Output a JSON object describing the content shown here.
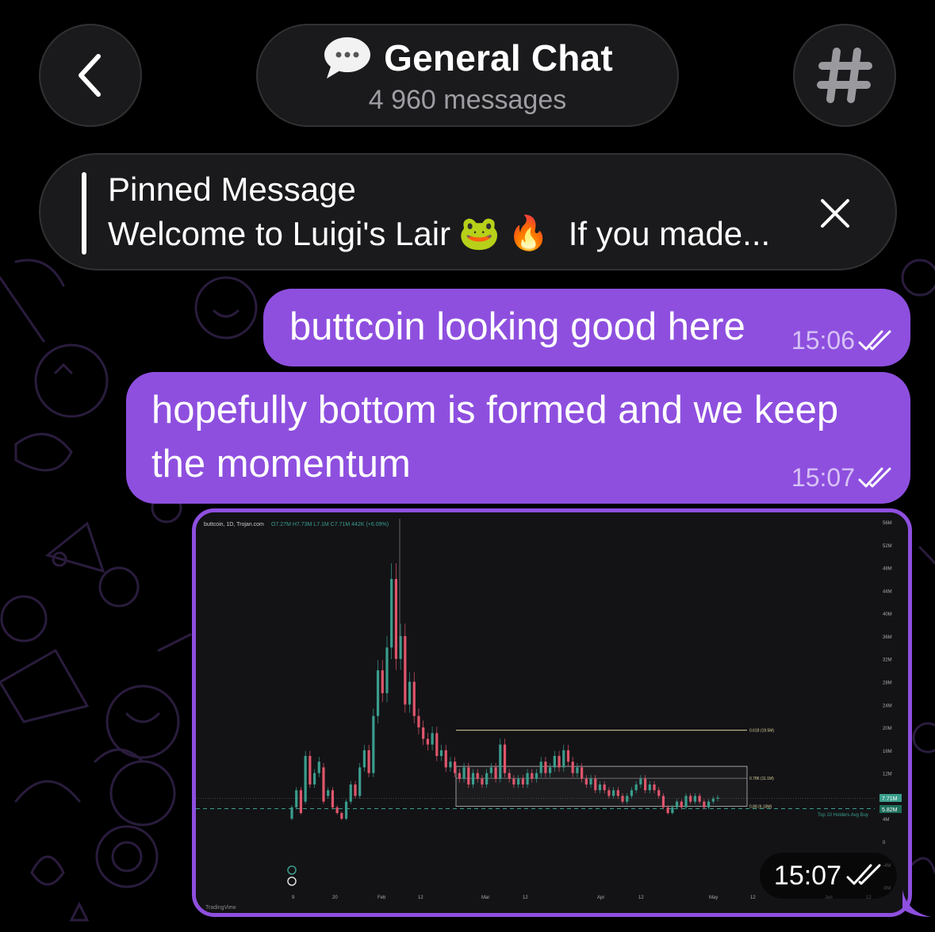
{
  "header": {
    "title": "General Chat",
    "subtitle": "4 960 messages",
    "chat_icon": "speech-bubble-icon",
    "back_icon": "chevron-left-icon",
    "topic_icon": "hashtag-icon"
  },
  "pinned": {
    "title": "Pinned Message",
    "text_before": "Welcome to Luigi's Lair",
    "emoji_1": "🐸",
    "emoji_2": "🔥",
    "text_after": "If you made...",
    "close_icon": "close-icon"
  },
  "messages": [
    {
      "text": "buttcoin looking good here",
      "time": "15:06",
      "status": "read"
    },
    {
      "text": "hopefully bottom is formed and we keep the momentum",
      "time": "15:07",
      "status": "read"
    }
  ],
  "image_message": {
    "time": "15:07",
    "status": "read"
  },
  "chart_data": {
    "type": "candlestick",
    "title": "buttcoin, 1D, Trojan.com",
    "ohlc_text": "O7.27M H7.73M L7.1M C7.71M 442K (+6.09%)",
    "x_ticks": [
      "9",
      "20",
      "Feb",
      "12",
      "Mar",
      "12",
      "Apr",
      "12",
      "May",
      "12",
      "Jun",
      "12"
    ],
    "y_ticks": [
      "56M",
      "52M",
      "48M",
      "44M",
      "40M",
      "36M",
      "32M",
      "28M",
      "24M",
      "20M",
      "16M",
      "12M",
      "4M",
      "0",
      "-4M",
      "-8M"
    ],
    "price_labels": {
      "last": "7.71M",
      "support": "5.82M"
    },
    "levels": [
      {
        "label": "0.618 (19.5M)",
        "value": 19.5
      },
      {
        "label": "0.786 (11.1M)",
        "value": 11.1
      },
      {
        "label": "0.88 (6.18M)",
        "value": 6.18
      }
    ],
    "annotation": "Top 10 Holders Avg Buy",
    "watermark": "TradingView",
    "colors": {
      "up": "#3a9d8c",
      "down": "#e0566b",
      "levels": "#d8d29a"
    }
  },
  "colors": {
    "bubble": "#8e4fdf",
    "background": "#000000"
  }
}
